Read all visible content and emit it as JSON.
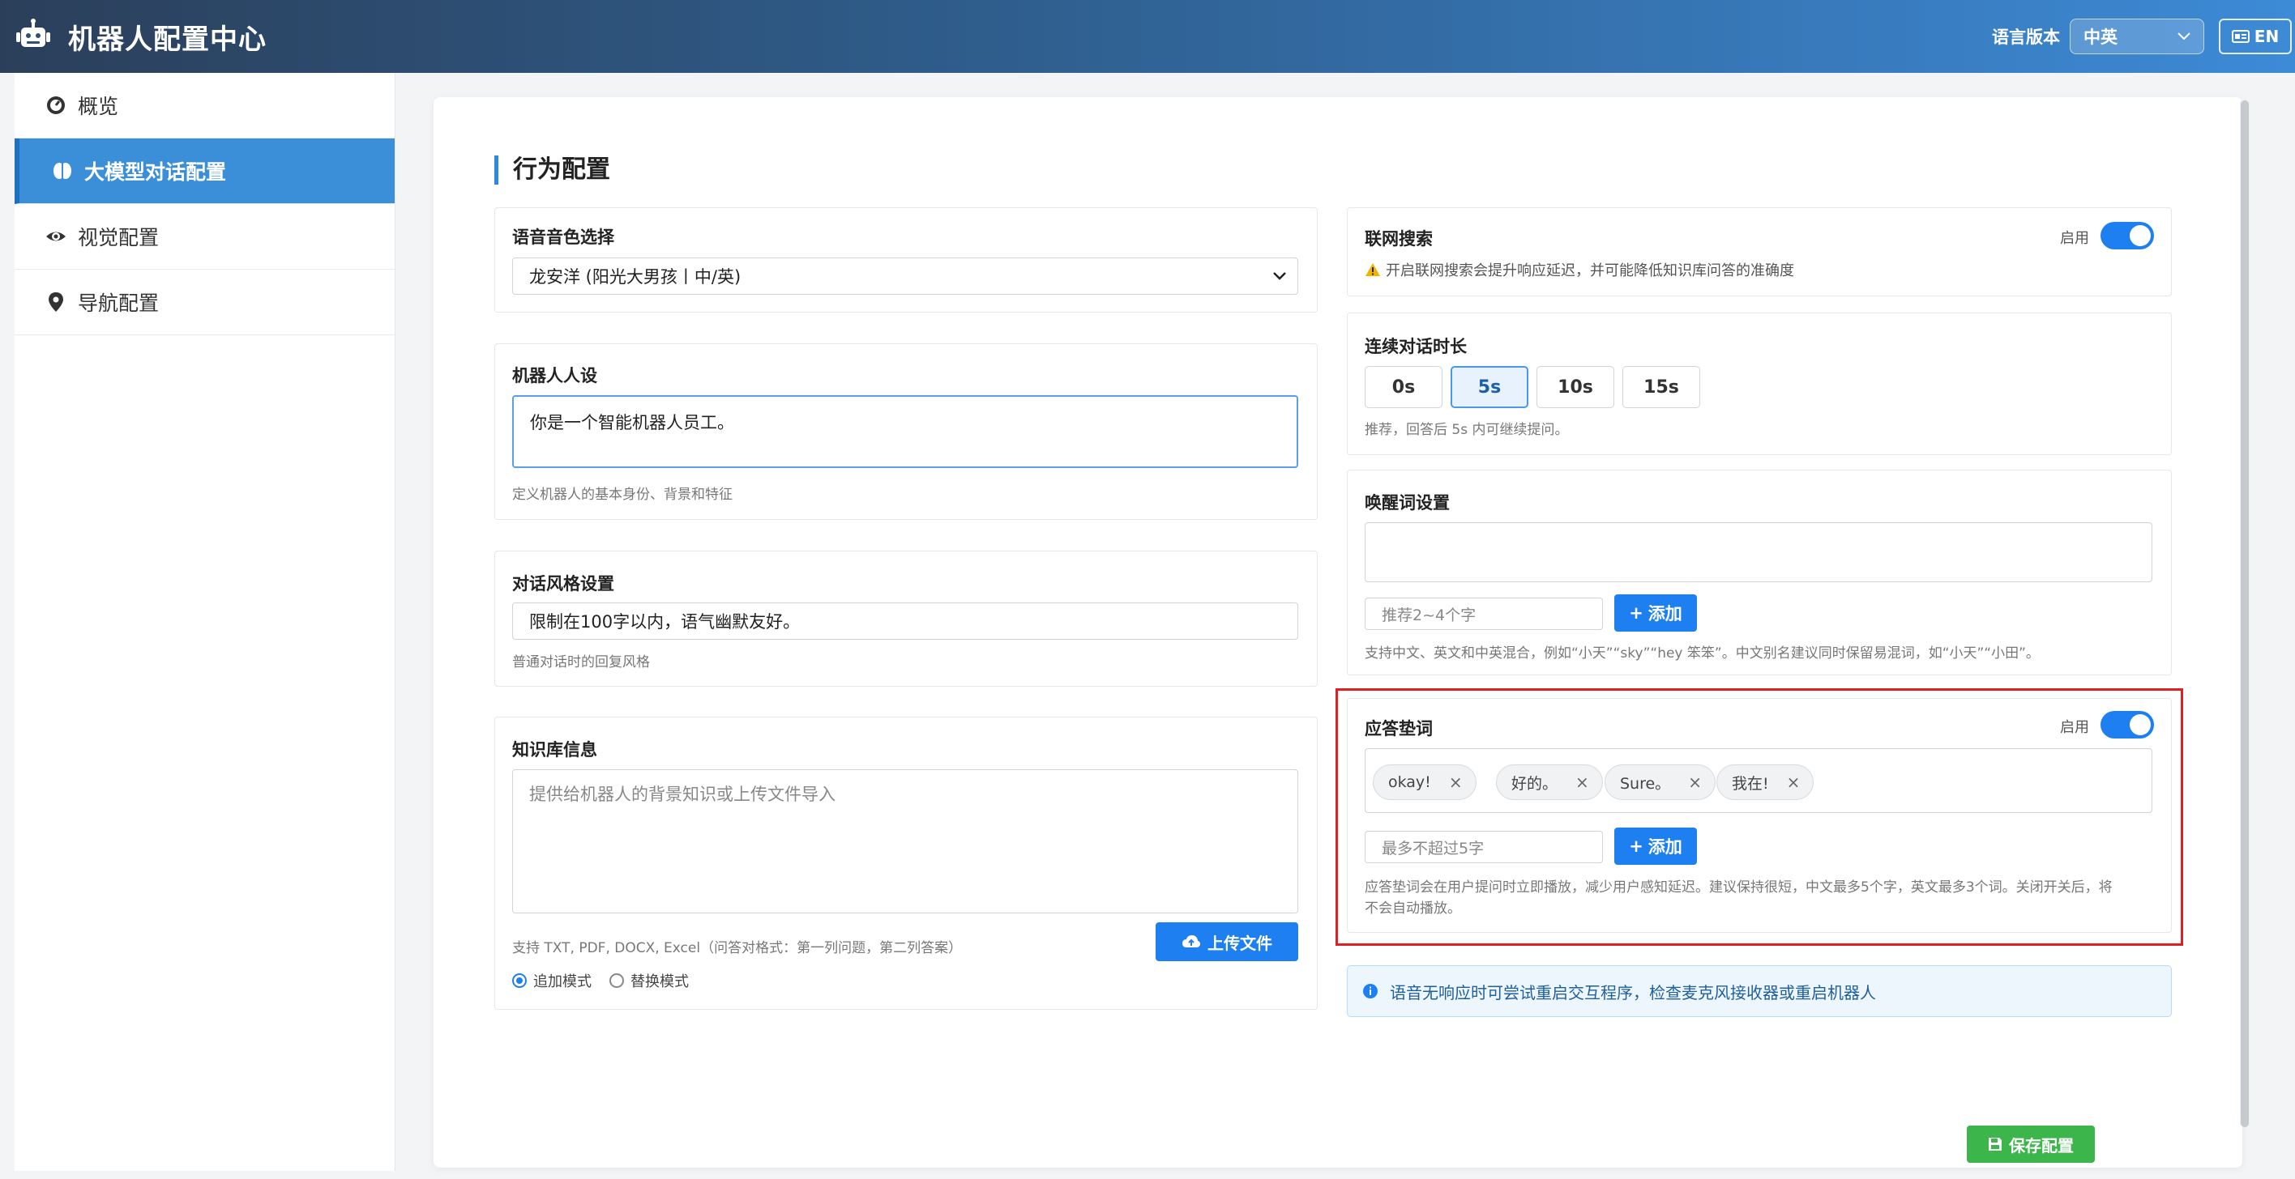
{
  "header": {
    "title": "机器人配置中心",
    "lang_label": "语言版本",
    "lang_selected": "中英",
    "lang_button": "EN"
  },
  "sidebar": {
    "items": [
      {
        "label": "概览",
        "icon": "dashboard-icon"
      },
      {
        "label": "大模型对话配置",
        "icon": "brain-icon",
        "active": true
      },
      {
        "label": "视觉配置",
        "icon": "eye-icon"
      },
      {
        "label": "导航配置",
        "icon": "map-pin-icon"
      }
    ]
  },
  "main": {
    "section_title": "行为配置",
    "voice": {
      "label": "语音音色选择",
      "selected": "龙安洋 (阳光大男孩丨中/英)"
    },
    "persona": {
      "label": "机器人人设",
      "value": "你是一个智能机器人员工。",
      "hint": "定义机器人的基本身份、背景和特征"
    },
    "style": {
      "label": "对话风格设置",
      "value": "限制在100字以内，语气幽默友好。",
      "hint": "普通对话时的回复风格"
    },
    "knowledge": {
      "label": "知识库信息",
      "placeholder": "提供给机器人的背景知识或上传文件导入",
      "hint": "支持 TXT, PDF, DOCX, Excel（问答对格式：第一列问题，第二列答案）",
      "upload_label": "上传文件",
      "mode_append": "追加模式",
      "mode_replace": "替换模式"
    },
    "web_search": {
      "label": "联网搜索",
      "toggle_label": "启用",
      "warning": "开启联网搜索会提升响应延迟，并可能降低知识库问答的准确度"
    },
    "duration": {
      "label": "连续对话时长",
      "options": [
        "0s",
        "5s",
        "10s",
        "15s"
      ],
      "selected": "5s",
      "hint": "推荐，回答后 5s 内可继续提问。"
    },
    "wake_word": {
      "label": "唤醒词设置",
      "input_placeholder": "推荐2~4个字",
      "add_label": "添加",
      "hint": "支持中文、英文和中英混合，例如“小天”“sky”“hey 笨笨”。中文别名建议同时保留易混词，如“小天”“小田”。"
    },
    "filler": {
      "label": "应答垫词",
      "toggle_label": "启用",
      "tags": [
        "okay!",
        "好的。",
        "Sure。",
        "我在!"
      ],
      "input_placeholder": "最多不超过5字",
      "add_label": "添加",
      "hint_line1": "应答垫词会在用户提问时立即播放，减少用户感知延迟。建议保持很短，中文最多5个字，英文最多3个词。关闭开关后，将",
      "hint_line2": "不会自动播放。"
    },
    "info": "语音无响应时可尝试重启交互程序，检查麦克风接收器或重启机器人",
    "save_label": "保存配置"
  },
  "colors": {
    "primary": "#1e7ff0",
    "sidebar_active": "#3b8fd9",
    "save": "#3cb54a",
    "highlight": "#e02020"
  }
}
